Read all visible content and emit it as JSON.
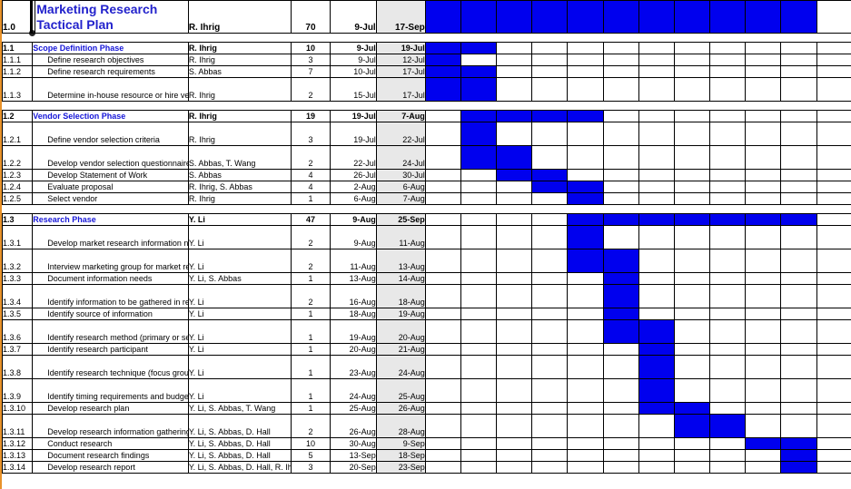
{
  "document": {
    "title": "Marketing Research Tactical Plan",
    "type": "gantt-chart-spreadsheet"
  },
  "colors": {
    "bar": "#0000EE",
    "summary_text": "#1616D8",
    "title_text": "#2222CC",
    "end_date_cell_bg": "#E8E8E8",
    "grid_line": "#000000",
    "selection_border": "#E8922A"
  },
  "gantt": {
    "column_count": 12,
    "bar_label": "task-bar"
  },
  "rows": [
    {
      "kind": "title",
      "wbs": "1.0",
      "task": "Marketing Research Tactical Plan",
      "resource": "R. Ihrig",
      "duration": "70",
      "start": "9-Jul",
      "end": "17-Sep",
      "bars": [
        1,
        1,
        1,
        1,
        1,
        1,
        1,
        1,
        1,
        1,
        1,
        0
      ]
    },
    {
      "kind": "spacer"
    },
    {
      "kind": "summary",
      "wbs": "1.1",
      "task": "Scope Definition Phase",
      "resource": "R. Ihrig",
      "duration": "10",
      "start": "9-Jul",
      "end": "19-Jul",
      "bars": [
        1,
        1,
        0,
        0,
        0,
        0,
        0,
        0,
        0,
        0,
        0,
        0
      ]
    },
    {
      "kind": "task",
      "wbs": "1.1.1",
      "task": "Define research objectives",
      "resource": "R. Ihrig",
      "duration": "3",
      "start": "9-Jul",
      "end": "12-Jul",
      "bars": [
        1,
        0,
        0,
        0,
        0,
        0,
        0,
        0,
        0,
        0,
        0,
        0
      ]
    },
    {
      "kind": "task",
      "wbs": "1.1.2",
      "task": "Define research requirements",
      "resource": "S. Abbas",
      "duration": "7",
      "start": "10-Jul",
      "end": "17-Jul",
      "bars": [
        1,
        1,
        0,
        0,
        0,
        0,
        0,
        0,
        0,
        0,
        0,
        0
      ]
    },
    {
      "kind": "task",
      "wbs": "1.1.3",
      "task": "Determine in-house resource or hire vendor",
      "resource": "R. Ihrig",
      "duration": "2",
      "start": "15-Jul",
      "end": "17-Jul",
      "bars": [
        1,
        1,
        0,
        0,
        0,
        0,
        0,
        0,
        0,
        0,
        0,
        0
      ]
    },
    {
      "kind": "spacer"
    },
    {
      "kind": "summary",
      "wbs": "1.2",
      "task": "Vendor Selection Phase",
      "resource": "R. Ihrig",
      "duration": "19",
      "start": "19-Jul",
      "end": "7-Aug",
      "bars": [
        0,
        1,
        1,
        1,
        1,
        0,
        0,
        0,
        0,
        0,
        0,
        0
      ]
    },
    {
      "kind": "task",
      "wbs": "1.2.1",
      "task": "Define vendor selection criteria",
      "resource": "R. Ihrig",
      "duration": "3",
      "start": "19-Jul",
      "end": "22-Jul",
      "bars": [
        0,
        1,
        0,
        0,
        0,
        0,
        0,
        0,
        0,
        0,
        0,
        0
      ]
    },
    {
      "kind": "task",
      "wbs": "1.2.2",
      "task": "Develop vendor selection questionnaire",
      "resource": "S. Abbas, T. Wang",
      "duration": "2",
      "start": "22-Jul",
      "end": "24-Jul",
      "bars": [
        0,
        1,
        1,
        0,
        0,
        0,
        0,
        0,
        0,
        0,
        0,
        0
      ]
    },
    {
      "kind": "task",
      "wbs": "1.2.3",
      "task": "Develop Statement of Work",
      "resource": "S. Abbas",
      "duration": "4",
      "start": "26-Jul",
      "end": "30-Jul",
      "bars": [
        0,
        0,
        1,
        1,
        0,
        0,
        0,
        0,
        0,
        0,
        0,
        0
      ]
    },
    {
      "kind": "task",
      "wbs": "1.2.4",
      "task": "Evaluate proposal",
      "resource": "R. Ihrig, S. Abbas",
      "duration": "4",
      "start": "2-Aug",
      "end": "6-Aug",
      "bars": [
        0,
        0,
        0,
        1,
        1,
        0,
        0,
        0,
        0,
        0,
        0,
        0
      ]
    },
    {
      "kind": "task",
      "wbs": "1.2.5",
      "task": "Select vendor",
      "resource": "R. Ihrig",
      "duration": "1",
      "start": "6-Aug",
      "end": "7-Aug",
      "bars": [
        0,
        0,
        0,
        0,
        1,
        0,
        0,
        0,
        0,
        0,
        0,
        0
      ]
    },
    {
      "kind": "spacer"
    },
    {
      "kind": "summary",
      "wbs": "1.3",
      "task": "Research Phase",
      "resource": "Y. Li",
      "duration": "47",
      "start": "9-Aug",
      "end": "25-Sep",
      "bars": [
        0,
        0,
        0,
        0,
        1,
        1,
        1,
        1,
        1,
        1,
        1,
        0
      ]
    },
    {
      "kind": "task",
      "wbs": "1.3.1",
      "task": "Develop market research information needs questionnaire",
      "resource": "Y. Li",
      "duration": "2",
      "start": "9-Aug",
      "end": "11-Aug",
      "bars": [
        0,
        0,
        0,
        0,
        1,
        0,
        0,
        0,
        0,
        0,
        0,
        0
      ]
    },
    {
      "kind": "task",
      "wbs": "1.3.2",
      "task": "Interview marketing group for market research needs",
      "resource": "Y. Li",
      "duration": "2",
      "start": "11-Aug",
      "end": "13-Aug",
      "bars": [
        0,
        0,
        0,
        0,
        1,
        1,
        0,
        0,
        0,
        0,
        0,
        0
      ]
    },
    {
      "kind": "task",
      "wbs": "1.3.3",
      "task": "Document information needs",
      "resource": "Y. Li, S. Abbas",
      "duration": "1",
      "start": "13-Aug",
      "end": "14-Aug",
      "bars": [
        0,
        0,
        0,
        0,
        0,
        1,
        0,
        0,
        0,
        0,
        0,
        0
      ]
    },
    {
      "kind": "task",
      "wbs": "1.3.4",
      "task": "Identify information to be gathered in research",
      "resource": "Y. Li",
      "duration": "2",
      "start": "16-Aug",
      "end": "18-Aug",
      "bars": [
        0,
        0,
        0,
        0,
        0,
        1,
        0,
        0,
        0,
        0,
        0,
        0
      ]
    },
    {
      "kind": "task",
      "wbs": "1.3.5",
      "task": "Identify source of information",
      "resource": "Y. Li",
      "duration": "1",
      "start": "18-Aug",
      "end": "19-Aug",
      "bars": [
        0,
        0,
        0,
        0,
        0,
        1,
        0,
        0,
        0,
        0,
        0,
        0
      ]
    },
    {
      "kind": "task",
      "wbs": "1.3.6",
      "task": "Identify research method (primary or secondary)",
      "resource": "Y. Li",
      "duration": "1",
      "start": "19-Aug",
      "end": "20-Aug",
      "bars": [
        0,
        0,
        0,
        0,
        0,
        1,
        1,
        0,
        0,
        0,
        0,
        0
      ]
    },
    {
      "kind": "task",
      "wbs": "1.3.7",
      "task": "Identify research participant",
      "resource": "Y. Li",
      "duration": "1",
      "start": "20-Aug",
      "end": "21-Aug",
      "bars": [
        0,
        0,
        0,
        0,
        0,
        0,
        1,
        0,
        0,
        0,
        0,
        0
      ]
    },
    {
      "kind": "task",
      "wbs": "1.3.8",
      "task": "Identify research technique (focus group or survey)",
      "resource": "Y. Li",
      "duration": "1",
      "start": "23-Aug",
      "end": "24-Aug",
      "bars": [
        0,
        0,
        0,
        0,
        0,
        0,
        1,
        0,
        0,
        0,
        0,
        0
      ]
    },
    {
      "kind": "task",
      "wbs": "1.3.9",
      "task": "Identify timing requirements and budget",
      "resource": "Y. Li",
      "duration": "1",
      "start": "24-Aug",
      "end": "25-Aug",
      "bars": [
        0,
        0,
        0,
        0,
        0,
        0,
        1,
        0,
        0,
        0,
        0,
        0
      ]
    },
    {
      "kind": "task",
      "wbs": "1.3.10",
      "task": "Develop research plan",
      "resource": "Y. Li, S. Abbas, T. Wang",
      "duration": "1",
      "start": "25-Aug",
      "end": "26-Aug",
      "bars": [
        0,
        0,
        0,
        0,
        0,
        0,
        1,
        1,
        0,
        0,
        0,
        0
      ]
    },
    {
      "kind": "task",
      "wbs": "1.3.11",
      "task": "Develop research information gathering tool",
      "resource": "Y. Li, S. Abbas, D. Hall",
      "duration": "2",
      "start": "26-Aug",
      "end": "28-Aug",
      "bars": [
        0,
        0,
        0,
        0,
        0,
        0,
        0,
        1,
        1,
        0,
        0,
        0
      ]
    },
    {
      "kind": "task",
      "wbs": "1.3.12",
      "task": "Conduct research",
      "resource": "Y. Li, S. Abbas, D. Hall",
      "duration": "10",
      "start": "30-Aug",
      "end": "9-Sep",
      "bars": [
        0,
        0,
        0,
        0,
        0,
        0,
        0,
        0,
        0,
        1,
        1,
        0
      ]
    },
    {
      "kind": "task",
      "wbs": "1.3.13",
      "task": "Document research findings",
      "resource": "Y. Li, S. Abbas, D. Hall",
      "duration": "5",
      "start": "13-Sep",
      "end": "18-Sep",
      "bars": [
        0,
        0,
        0,
        0,
        0,
        0,
        0,
        0,
        0,
        0,
        1,
        0
      ]
    },
    {
      "kind": "task",
      "wbs": "1.3.14",
      "task": "Develop research report",
      "resource": "Y. Li, S. Abbas, D. Hall, R. Ihrig",
      "duration": "3",
      "start": "20-Sep",
      "end": "23-Sep",
      "bars": [
        0,
        0,
        0,
        0,
        0,
        0,
        0,
        0,
        0,
        0,
        1,
        0
      ]
    }
  ]
}
